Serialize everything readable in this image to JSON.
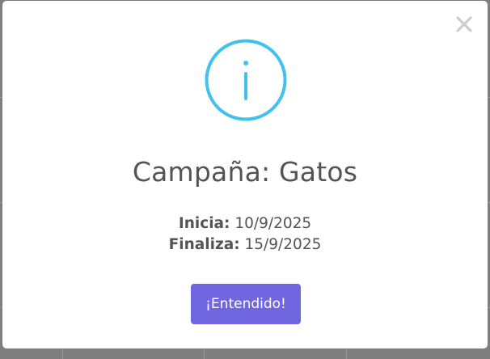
{
  "modal": {
    "title": "Campaña: Gatos",
    "start_label": "Inicia:",
    "start_value": "10/9/2025",
    "end_label": "Finaliza:",
    "end_value": "15/9/2025",
    "confirm_label": "¡Entendido!",
    "icon": "info-icon",
    "close_icon": "close-icon"
  },
  "colors": {
    "accent": "#7066e0",
    "info": "#3fc3ee",
    "text": "#545454",
    "close": "#cccccc"
  }
}
